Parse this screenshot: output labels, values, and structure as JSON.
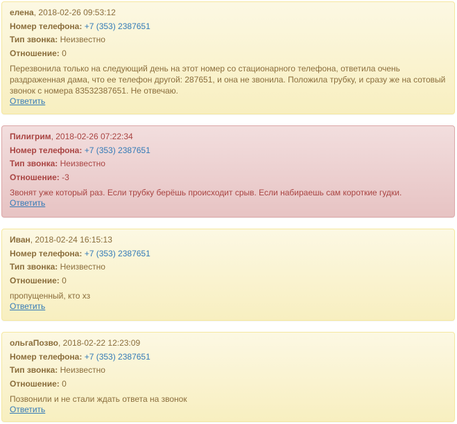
{
  "labels": {
    "phone": "Номер телефона:",
    "call_type": "Тип звонка:",
    "attitude": "Отношение:",
    "reply": "Ответить"
  },
  "comments": [
    {
      "author": "елена",
      "datetime": ", 2018-02-26 09:53:12",
      "phone": "+7 (353) 2387651",
      "call_type": "Неизвестно",
      "attitude": "0",
      "text": "Перезвонила только на следующий день на этот номер со стационарного телефона, ответила очень раздраженная дама, что ее телефон другой: 287651, и она не звонила. Положила трубку, и сразу же на сотовый звонок с номера 83532387651. Не отвечаю."
    },
    {
      "author": "Пилигрим",
      "datetime": ", 2018-02-26 07:22:34",
      "phone": "+7 (353) 2387651",
      "call_type": "Неизвестно",
      "attitude": "-3",
      "text": "Звонят уже который раз. Если трубку берёшь происходит срыв. Если набираешь сам короткие гудки."
    },
    {
      "author": "Иван",
      "datetime": ", 2018-02-24 16:15:13",
      "phone": "+7 (353) 2387651",
      "call_type": "Неизвестно",
      "attitude": "0",
      "text": "пропущенный, кто хз"
    },
    {
      "author": "ольгаПозво",
      "datetime": ", 2018-02-22 12:23:09",
      "phone": "+7 (353) 2387651",
      "call_type": "Неизвестно",
      "attitude": "0",
      "text": "Позвонили и не стали ждать ответа на звонок"
    }
  ]
}
